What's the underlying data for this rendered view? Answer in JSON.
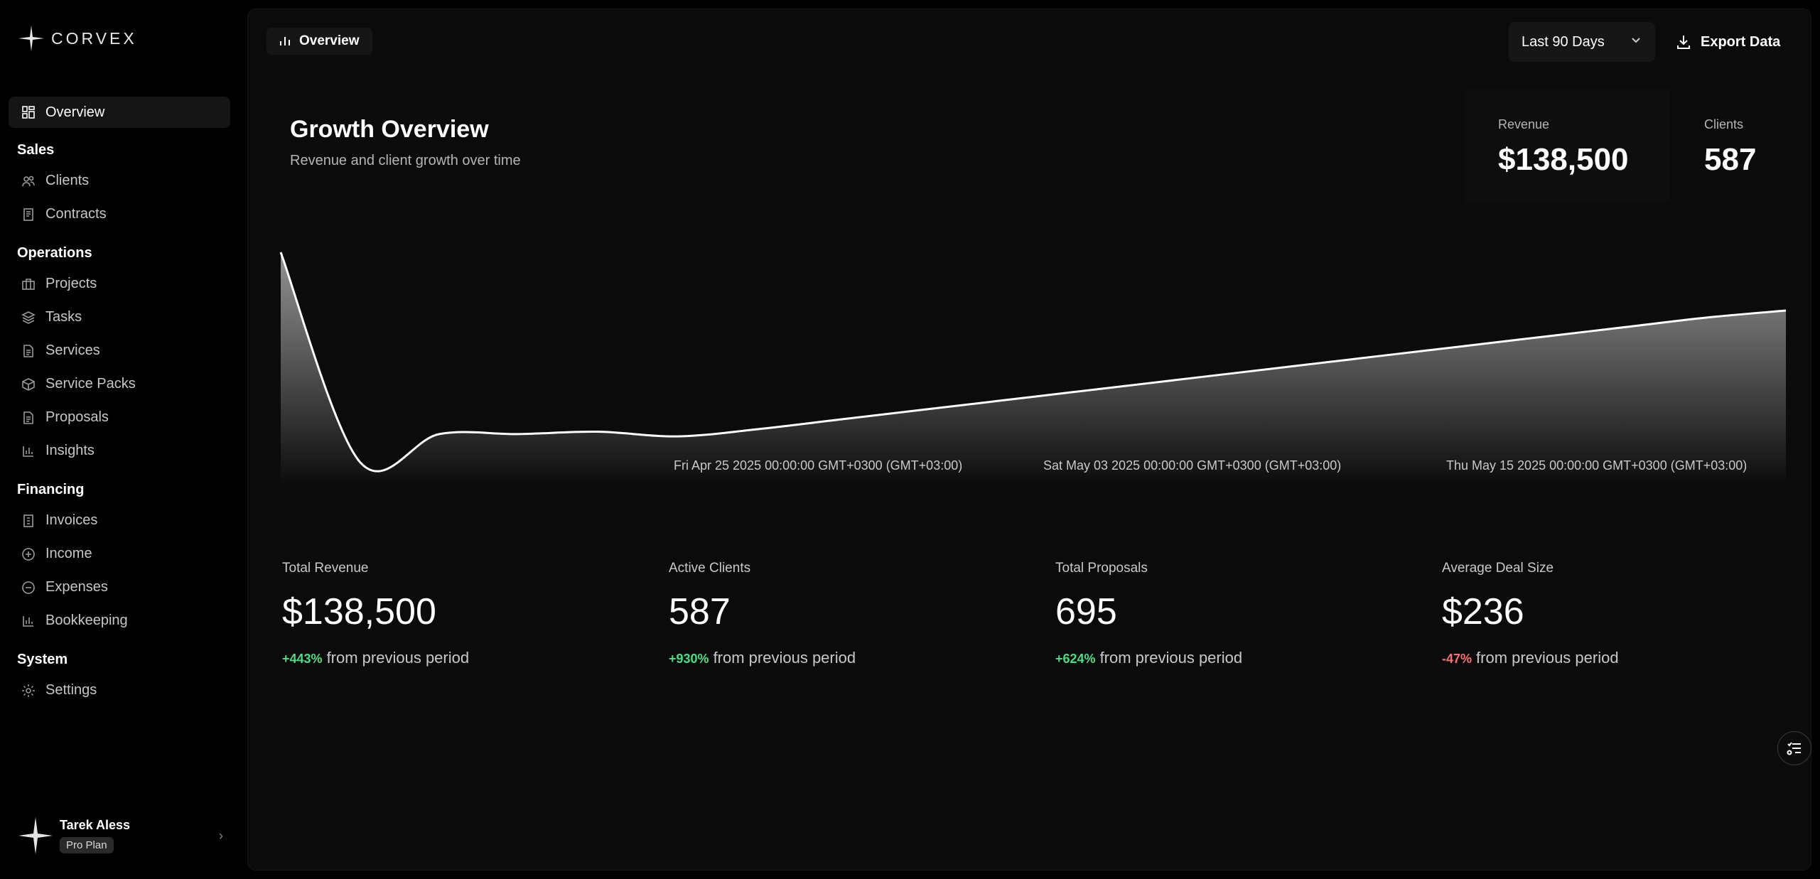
{
  "brand": {
    "name": "CORVEX"
  },
  "sidebar": {
    "overview": {
      "label": "Overview",
      "icon": "grid-icon"
    },
    "groups": [
      {
        "title": "Sales",
        "items": [
          {
            "label": "Clients",
            "icon": "users-icon"
          },
          {
            "label": "Contracts",
            "icon": "contract-icon"
          }
        ]
      },
      {
        "title": "Operations",
        "items": [
          {
            "label": "Projects",
            "icon": "briefcase-icon"
          },
          {
            "label": "Tasks",
            "icon": "layers-icon"
          },
          {
            "label": "Services",
            "icon": "file-icon"
          },
          {
            "label": "Service Packs",
            "icon": "box-icon"
          },
          {
            "label": "Proposals",
            "icon": "file-icon"
          },
          {
            "label": "Insights",
            "icon": "bar-chart-icon"
          }
        ]
      },
      {
        "title": "Financing",
        "items": [
          {
            "label": "Invoices",
            "icon": "invoice-icon"
          },
          {
            "label": "Income",
            "icon": "plus-circle-icon"
          },
          {
            "label": "Expenses",
            "icon": "minus-circle-icon"
          },
          {
            "label": "Bookkeeping",
            "icon": "bar-chart-icon"
          }
        ]
      },
      {
        "title": "System",
        "items": [
          {
            "label": "Settings",
            "icon": "gear-icon"
          }
        ]
      }
    ]
  },
  "user": {
    "name": "Tarek Aless",
    "plan": "Pro Plan"
  },
  "topbar": {
    "tab": "Overview",
    "range": "Last 90 Days",
    "export": "Export Data"
  },
  "growth": {
    "title": "Growth Overview",
    "subtitle": "Revenue and client growth over time",
    "kpis": {
      "revenue_label": "Revenue",
      "revenue_value": "$138,500",
      "clients_label": "Clients",
      "clients_value": "587"
    }
  },
  "chart_data": {
    "type": "area",
    "title": "",
    "xlabel": "",
    "ylabel": "",
    "x_ticks": [
      "Fri Apr 25 2025 00:00:00 GMT+0300 (GMT+03:00)",
      "Sat May 03 2025 00:00:00 GMT+0300 (GMT+03:00)",
      "Thu May 15 2025 00:00:00 GMT+0300 (GMT+03:00)"
    ],
    "values": [
      100,
      10,
      22,
      22,
      23,
      21,
      24,
      28,
      32,
      36,
      40,
      44,
      48,
      52,
      56,
      60,
      64,
      68,
      72,
      75
    ],
    "ylim": [
      0,
      100
    ],
    "grid": false,
    "legend": "none"
  },
  "stats": [
    {
      "label": "Total Revenue",
      "value": "$138,500",
      "delta": "+443%",
      "delta_text": "from previous period",
      "trend": "up"
    },
    {
      "label": "Active Clients",
      "value": "587",
      "delta": "+930%",
      "delta_text": "from previous period",
      "trend": "up"
    },
    {
      "label": "Total Proposals",
      "value": "695",
      "delta": "+624%",
      "delta_text": "from previous period",
      "trend": "up"
    },
    {
      "label": "Average Deal Size",
      "value": "$236",
      "delta": "-47%",
      "delta_text": "from previous period",
      "trend": "down"
    }
  ],
  "colors": {
    "positive": "#4ade80",
    "negative": "#f87171",
    "accent": "#ffffff"
  }
}
